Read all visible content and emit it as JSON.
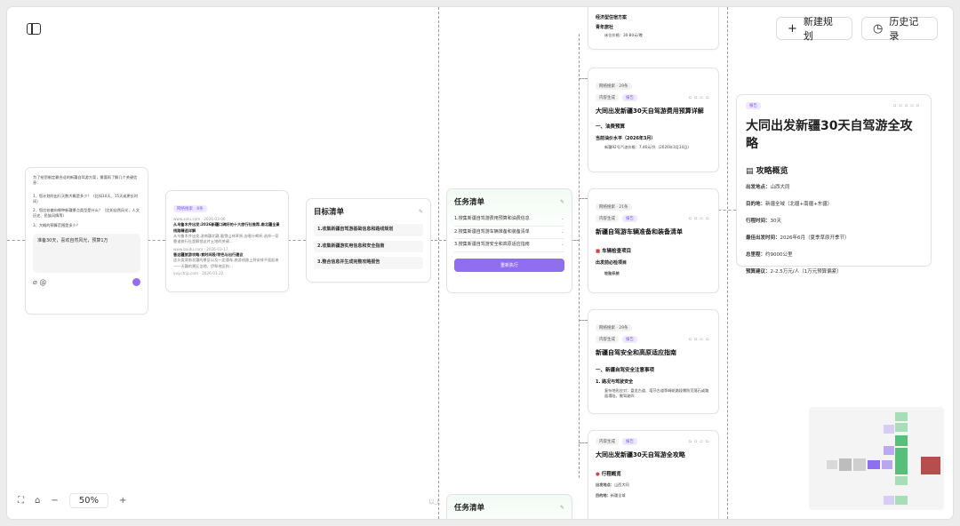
{
  "header": {
    "new_plan_label": "新建规划",
    "history_label": "历史记录"
  },
  "prompt_card": {
    "intro": "为了给您制定最合适的新疆自驾游方案，需要再了解几个关键信息：",
    "q1": "1、您计划的出行天数大概是多少？（比如10天、15天或更长时间）",
    "q2": "2、您比较偏向哪种新疆景点类型是什么？（比如自然风光、人文历史、民族风情等）",
    "q3": "3、大概的预算范围是多少？",
    "answer": "准备30天，喜欢自然风光，预算1万"
  },
  "search_card": {
    "badge": "网络搜索 · 8条",
    "r1_src": "www.xxlu.com · 2026-03-06",
    "r1_title": "从乌鲁木齐出发:2026新疆口碑好的十大旅行社推荐,南北疆全景线路精选详解",
    "r1_desc": "从乌鲁木齐出发,游南疆北疆,看雪山林草原,去喀什喝杯,选择一家靠谱旅行社是解锁这片土地的关键...",
    "r2_src": "www.baidu.com · 2026-03-17",
    "r2_title": "香这疆旅游攻略:食时间段/特色与出行建议",
    "r2_desc": "这头类背南北疆的景区以及一定通车,旅游线路上到安排平面起来——天疆的景区泊地、伊犁地区和...",
    "r3_src": "yuy.ctrip.com · 2026-01-22"
  },
  "goal_card": {
    "title": "目标清单",
    "g1": "1.收集新疆自驾游基础信息和路线规划",
    "g2": "2.收集新疆游实用信息和安全指南",
    "g3": "3.整合信息并生成完整攻略报告"
  },
  "task_card": {
    "title": "任务清单",
    "t1": "1.搜集新疆自驾游费用预算和油费信息",
    "t2": "2.搜集新疆自驾游车辆准备和装备清单",
    "t3": "3.搜集新疆自驾游安全和高原适应指南",
    "run_label": "重新执行"
  },
  "task_card2": {
    "title": "任务清单"
  },
  "top_partial": {
    "line1": "经济型住宿方案",
    "line2": "青年旅社",
    "line3": "床位价格：30-80元/晚"
  },
  "budget_card": {
    "badge": "网络搜索 · 29条",
    "chip1": "内容生成",
    "chip2": "报告",
    "title": "大同出发新疆30天自驾游费用预算详解",
    "sec": "一、油费预算",
    "sub": "当前油价水平（2026年3月）",
    "line": "新疆92号汽油价格：7.46元/升（2026年3月14日）"
  },
  "vehicle_card": {
    "badge": "网络搜索 · 21条",
    "chip1": "内容生成",
    "chip2": "报告",
    "title": "新疆自驾游车辆准备和装备清单",
    "sec": "车辆检查项目",
    "sub": "出发前必检项目",
    "line": "轮胎系统"
  },
  "safety_card": {
    "badge": "网络搜索 · 29条",
    "chip1": "内容生成",
    "chip2": "报告",
    "title": "新疆自驾安全和高原适应指南",
    "sec": "一、新疆自驾安全注意事项",
    "sub": "1. 路况与驾驶安全",
    "line": "复杂地形应对：盘龙古道、塔莎古道等崎岖路段需防范落石或路面塌陷，需驾驶四"
  },
  "guide_card": {
    "chip1": "内容生成",
    "chip2": "报告",
    "title": "大同出发新疆30天自驾游全攻略",
    "sec": "行程概览",
    "l1_k": "出发地点：",
    "l1_v": "山西大同",
    "l2_k": "目的地：",
    "l2_v": "新疆全域"
  },
  "report_panel": {
    "badge": "报告",
    "title": "大同出发新疆30天自驾游全攻略",
    "section": "攻略概览",
    "rows": [
      {
        "k": "出发地点：",
        "v": "山西大同"
      },
      {
        "k": "目的地：",
        "v": "新疆全域（北疆+南疆+东疆）"
      },
      {
        "k": "行程时间：",
        "v": "30天"
      },
      {
        "k": "最佳出发时间：",
        "v": "2026年6月（夏季草原开季节）"
      },
      {
        "k": "总里程：",
        "v": "约9000公里"
      },
      {
        "k": "预算建议：",
        "v": "2-2.5万元/人（1万元预算偏紧）"
      }
    ]
  },
  "canvas_controls": {
    "zoom": "50%",
    "bottom_hint": "以上"
  },
  "colors": {
    "accent": "#8f6ef0",
    "report_red": "#b84d4d",
    "minimap_green": "#56c07a"
  }
}
